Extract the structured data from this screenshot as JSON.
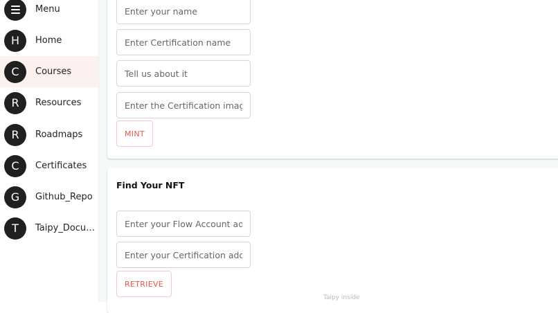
{
  "sidebar": {
    "items": [
      {
        "avatar": "",
        "label": "Menu",
        "icon": "hamburger-menu-icon"
      },
      {
        "avatar": "H",
        "label": "Home"
      },
      {
        "avatar": "C",
        "label": "Courses",
        "active": true
      },
      {
        "avatar": "R",
        "label": "Resources"
      },
      {
        "avatar": "R",
        "label": "Roadmaps"
      },
      {
        "avatar": "C",
        "label": "Certificates"
      },
      {
        "avatar": "G",
        "label": "Github_Repo"
      },
      {
        "avatar": "T",
        "label": "Taipy_Docum..."
      }
    ]
  },
  "mint_form": {
    "name_placeholder": "Enter your name",
    "cert_name_placeholder": "Enter Certification name",
    "description_placeholder": "Tell us about it",
    "image_placeholder": "Enter the Certification image...",
    "mint_label": "MINT"
  },
  "find_nft": {
    "title": "Find Your NFT",
    "flow_account_placeholder": "Enter your Flow Account add...",
    "cert_address_placeholder": "Enter your Certification addr...",
    "retrieve_label": "RETRIEVE"
  },
  "footer": {
    "note": "Taipy inside"
  },
  "colors": {
    "accent": "#e2574c",
    "active_bg": "#fdf1ef",
    "avatar_bg": "#202020",
    "main_bg": "#f4f8f9"
  }
}
